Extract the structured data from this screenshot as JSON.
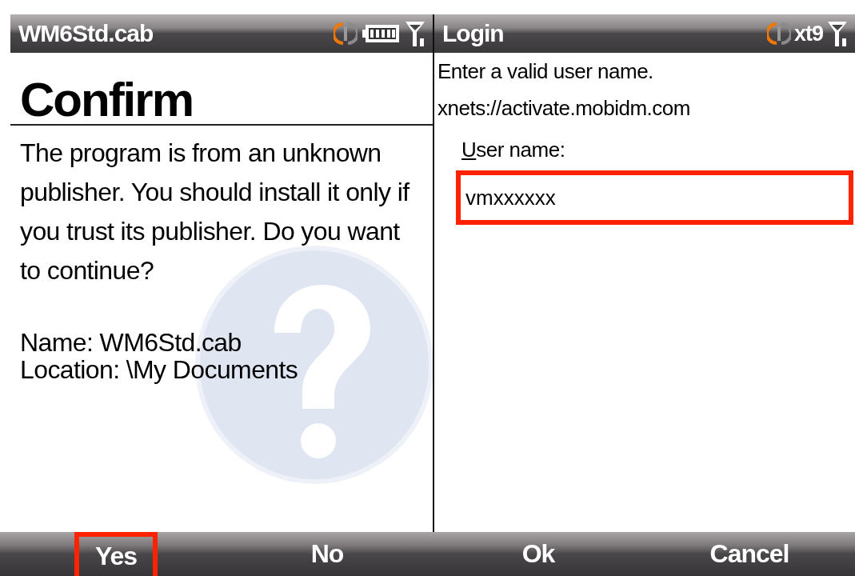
{
  "screens": [
    {
      "kind": "confirm",
      "title": "WM6Std.cab",
      "heading": "Confirm",
      "message": "The program is from an unknown publisher. You should install it only if you trust its publisher. Do you want to continue?",
      "details": [
        "Name: WM6Std.cab",
        "Location: \\My Documents"
      ],
      "softkeys": [
        {
          "label": "Yes",
          "highlighted": true
        },
        {
          "label": "No",
          "highlighted": false
        }
      ]
    },
    {
      "kind": "login",
      "title": "Login",
      "input_mode": "xt9",
      "prompt": "Enter a valid user name.",
      "server": "xnets://activate.mobidm.com",
      "field": {
        "label": "User name:",
        "access_key_underlined": true,
        "value": "vmxxxxxx",
        "highlighted": true
      },
      "softkeys": [
        {
          "label": "Ok",
          "highlighted": false
        },
        {
          "label": "Cancel",
          "highlighted": false
        }
      ]
    }
  ]
}
